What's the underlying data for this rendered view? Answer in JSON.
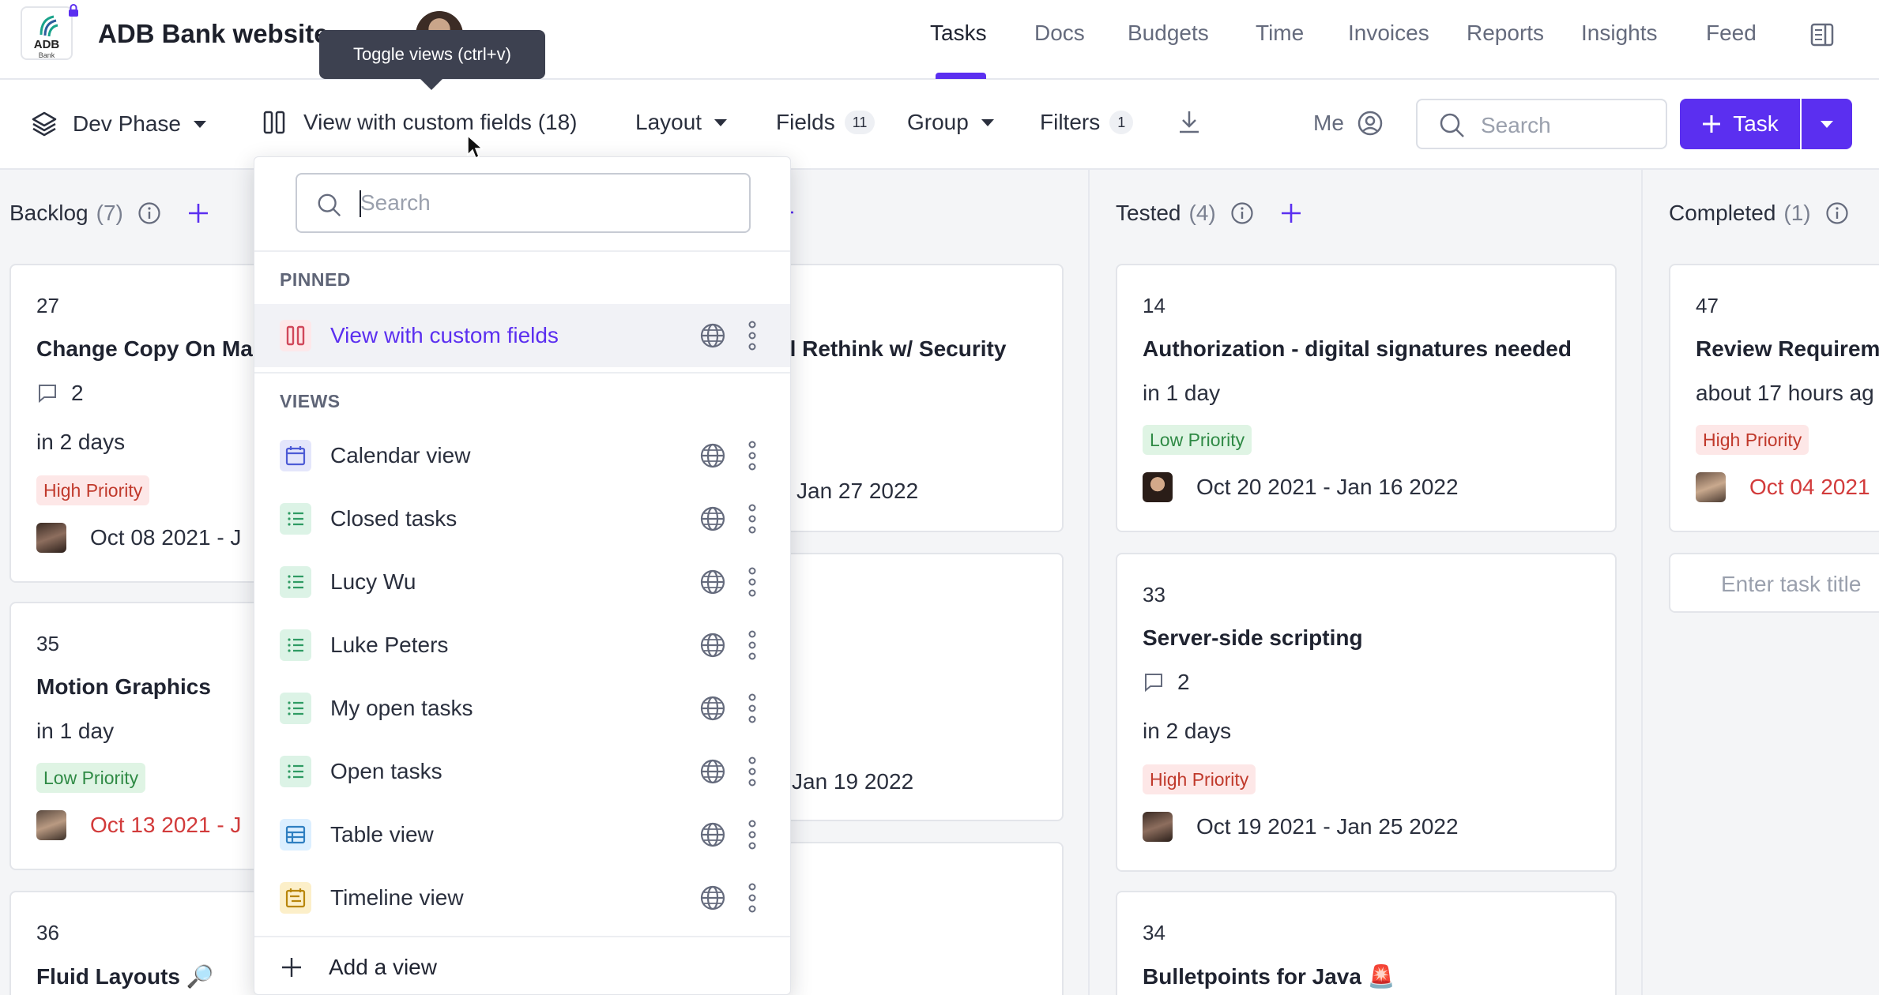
{
  "app": {
    "title": "ADB Bank website",
    "logo_text": "ADB",
    "logo_subtext": "Bank"
  },
  "nav": {
    "links": [
      {
        "label": "Tasks",
        "active": true
      },
      {
        "label": "Docs"
      },
      {
        "label": "Budgets"
      },
      {
        "label": "Time"
      },
      {
        "label": "Invoices"
      },
      {
        "label": "Reports"
      },
      {
        "label": "Insights"
      },
      {
        "label": "Feed"
      }
    ]
  },
  "tooltip": "Toggle views (ctrl+v)",
  "toolbar": {
    "phase": "Dev Phase",
    "view": "View with custom fields (18)",
    "layout": "Layout",
    "fields": "Fields",
    "fields_count": "11",
    "group": "Group",
    "filters": "Filters",
    "filters_count": "1",
    "me": "Me",
    "search_placeholder": "Search",
    "task_button": "Task"
  },
  "columns": [
    {
      "name": "Backlog",
      "count": "(7)"
    },
    {
      "name": "Tested",
      "count": "(4)"
    },
    {
      "name": "Completed",
      "count": "(1)"
    }
  ],
  "cards": {
    "backlog": [
      {
        "num": "27",
        "title": "Change Copy On Ma",
        "comments": "2",
        "due": "in 2 days",
        "priority": "High Priority",
        "dates": "Oct 08 2021 - J"
      },
      {
        "num": "35",
        "title": "Motion Graphics",
        "due": "in 1 day",
        "priority": "Low Priority",
        "dates": "Oct 13 2021 - J"
      },
      {
        "num": "36",
        "title": "Fluid Layouts 🔎"
      }
    ],
    "middle": [
      {
        "title": "al Rethink w/ Security",
        "dates": "Jan 27 2022"
      },
      {
        "dates": "Jan 19 2022"
      }
    ],
    "tested": [
      {
        "num": "14",
        "title": "Authorization - digital signatures needed",
        "due": "in 1 day",
        "priority": "Low Priority",
        "dates": "Oct 20 2021 - Jan 16 2022"
      },
      {
        "num": "33",
        "title": "Server-side scripting",
        "comments": "2",
        "due": "in 2 days",
        "priority": "High Priority",
        "dates": "Oct 19 2021 - Jan 25 2022"
      },
      {
        "num": "34",
        "title": "Bulletpoints for Java 🚨"
      }
    ],
    "completed": [
      {
        "num": "47",
        "title": "Review Requireme",
        "due": "about 17 hours ag",
        "priority": "High Priority",
        "dates": "Oct 04 2021"
      }
    ],
    "enter_task_placeholder": "Enter task title"
  },
  "dropdown": {
    "search_placeholder": "Search",
    "pinned_header": "PINNED",
    "pinned": [
      {
        "label": "View with custom fields",
        "icon": "columns-icon"
      }
    ],
    "views_header": "VIEWS",
    "views": [
      {
        "label": "Calendar view",
        "icon": "calendar-icon"
      },
      {
        "label": "Closed tasks",
        "icon": "list-icon"
      },
      {
        "label": "Lucy Wu",
        "icon": "list-icon"
      },
      {
        "label": "Luke Peters",
        "icon": "list-icon"
      },
      {
        "label": "My open tasks",
        "icon": "list-icon"
      },
      {
        "label": "Open tasks",
        "icon": "list-icon"
      },
      {
        "label": "Table view",
        "icon": "table-icon"
      },
      {
        "label": "Timeline view",
        "icon": "timeline-icon"
      }
    ],
    "add_view": "Add a view"
  },
  "colors": {
    "accent": "#5b2ff0",
    "high_priority_bg": "#fde7e7",
    "low_priority_bg": "#dff4e4",
    "overdue": "#d23b3b"
  }
}
